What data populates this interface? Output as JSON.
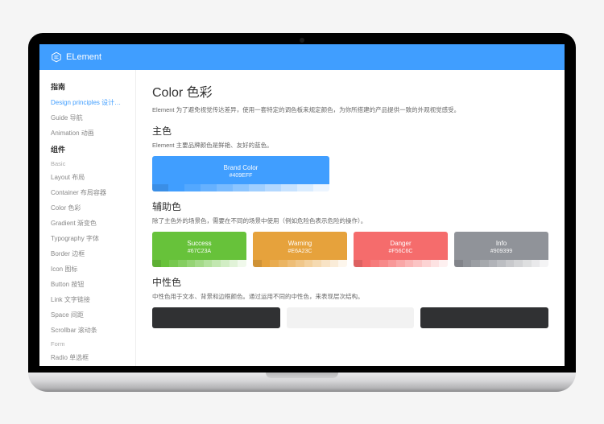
{
  "brand": "ELement",
  "sidebar": {
    "group1_title": "指南",
    "group1": [
      {
        "label": "Design principles 设计原则",
        "active": true
      },
      {
        "label": "Guide 导航"
      },
      {
        "label": "Animation 动画"
      }
    ],
    "group2_title": "组件",
    "group2_sub1": "Basic",
    "group2_a": [
      {
        "label": "Layout 布局"
      },
      {
        "label": "Container 布局容器"
      },
      {
        "label": "Color 色彩"
      },
      {
        "label": "Gradient 渐变色"
      },
      {
        "label": "Typography 字体"
      },
      {
        "label": "Border 边框"
      },
      {
        "label": "Icon 图标"
      },
      {
        "label": "Button 按钮"
      },
      {
        "label": "Link 文字链接"
      },
      {
        "label": "Space 间距"
      },
      {
        "label": "Scrollbar 滚动条"
      }
    ],
    "group2_sub2": "Form",
    "group2_b": [
      {
        "label": "Radio 单选框"
      }
    ]
  },
  "page": {
    "title": "Color 色彩",
    "desc": "Element 为了避免视觉传达差异，使用一套特定的调色板来规定颜色，为你所搭建的产品提供一致的外观视觉感受。",
    "s1_title": "主色",
    "s1_desc": "Element 主要品牌颜色是鲜艳、友好的蓝色。",
    "brand_color": {
      "name": "Brand Color",
      "hex": "#409EFF"
    },
    "s2_title": "辅助色",
    "s2_desc": "除了主色外的场景色，需要在不同的场景中使用（例如危险色表示危险的操作）。",
    "aux": [
      {
        "name": "Success",
        "hex": "#67C23A",
        "cls": "success"
      },
      {
        "name": "Warning",
        "hex": "#E6A23C",
        "cls": "warning"
      },
      {
        "name": "Danger",
        "hex": "#F56C6C",
        "cls": "danger"
      },
      {
        "name": "Info",
        "hex": "#909399",
        "cls": "info"
      }
    ],
    "s3_title": "中性色",
    "s3_desc": "中性色用于文本、背景和边框颜色。通过运用不同的中性色，来表现层次结构。"
  },
  "shades": {
    "brand": [
      "#3a8ee6",
      "#409eff",
      "#53a8ff",
      "#66b1ff",
      "#79bbff",
      "#8cc5ff",
      "#a0cfff",
      "#b3d8ff",
      "#c6e2ff",
      "#d9ecff",
      "#ecf5ff"
    ],
    "success": [
      "#5daf34",
      "#67c23a",
      "#76c84e",
      "#85ce61",
      "#95d475",
      "#a4da89",
      "#b3e19d",
      "#c2e7b0",
      "#d1edc4",
      "#e1f3d8",
      "#f0f9eb"
    ],
    "warning": [
      "#cf9236",
      "#e6a23c",
      "#e9ac50",
      "#ebb563",
      "#eebe77",
      "#f0c78a",
      "#f3d19e",
      "#f5dab1",
      "#f8e3c5",
      "#faecd8",
      "#fdf6ec"
    ],
    "danger": [
      "#dd6161",
      "#f56c6c",
      "#f67b7b",
      "#f78989",
      "#f89898",
      "#f9a7a7",
      "#fab6b6",
      "#fbc4c4",
      "#fcd3d3",
      "#fde2e2",
      "#fef0f0"
    ],
    "info": [
      "#82848a",
      "#909399",
      "#9b9ea3",
      "#a6a9ad",
      "#b1b3b8",
      "#bcbec2",
      "#c8c9cc",
      "#d3d4d6",
      "#dedfe0",
      "#e9e9eb",
      "#f4f4f5"
    ]
  }
}
